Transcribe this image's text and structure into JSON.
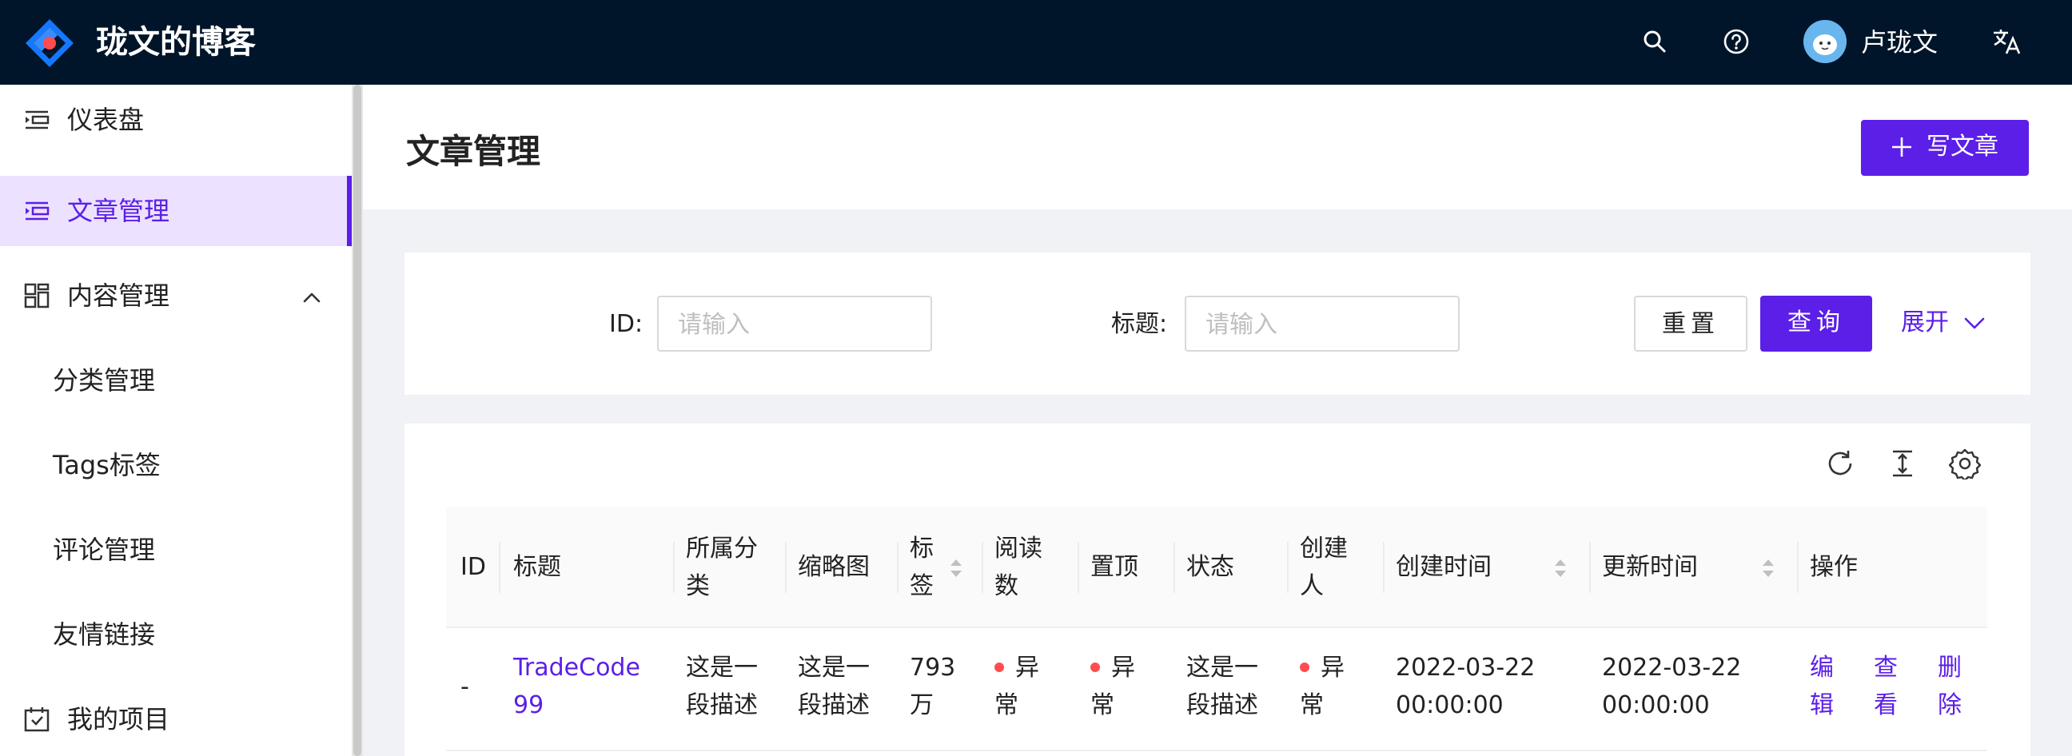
{
  "header": {
    "site_title": "珑文的博客",
    "user_name": "卢珑文"
  },
  "sidebar": {
    "items": [
      {
        "label": "仪表盘",
        "icon": "dashboard-icon"
      },
      {
        "label": "文章管理",
        "icon": "article-icon",
        "active": true
      },
      {
        "label": "内容管理",
        "icon": "content-icon",
        "expanded": true
      },
      {
        "label": "分类管理"
      },
      {
        "label": "Tags标签"
      },
      {
        "label": "评论管理"
      },
      {
        "label": "友情链接"
      },
      {
        "label": "我的项目",
        "icon": "project-icon"
      }
    ]
  },
  "page": {
    "title": "文章管理",
    "write_button": "写文章"
  },
  "search": {
    "id_label": "ID",
    "id_placeholder": "请输入",
    "title_label": "标题",
    "title_placeholder": "请输入",
    "reset": "重置",
    "query": "查询",
    "expand": "展开"
  },
  "table": {
    "columns": [
      "ID",
      "标题",
      "所属分类",
      "缩略图",
      "标签",
      "阅读数",
      "置顶",
      "状态",
      "创建人",
      "创建时间",
      "更新时间",
      "操作"
    ],
    "columns_wrapped": {
      "category": [
        "所属分",
        "类"
      ],
      "tags": [
        "标",
        "签"
      ],
      "reads": [
        "阅读",
        "数"
      ],
      "creator": [
        "创建",
        "人"
      ]
    },
    "rows": [
      {
        "id": "-",
        "title": [
          "TradeCode",
          "99"
        ],
        "category": [
          "这是一",
          "段描述"
        ],
        "thumbnail": [
          "这是一",
          "段描述"
        ],
        "tags": [
          "793",
          "万"
        ],
        "reads": [
          "异",
          "常"
        ],
        "top": [
          "异",
          "常"
        ],
        "status": [
          "这是一",
          "段描述"
        ],
        "creator": [
          "异",
          "常"
        ],
        "created": [
          "2022-03-22",
          "00:00:00"
        ],
        "updated": [
          "2022-03-22",
          "00:00:00"
        ],
        "actions": [
          [
            "编",
            "辑"
          ],
          [
            "查",
            "看"
          ],
          [
            "删",
            "除"
          ]
        ]
      }
    ]
  },
  "colors": {
    "header_bg": "#001529",
    "primary": "#5b1fe8",
    "active_bg": "#ece1ff",
    "error_dot": "#ff4d4f"
  }
}
